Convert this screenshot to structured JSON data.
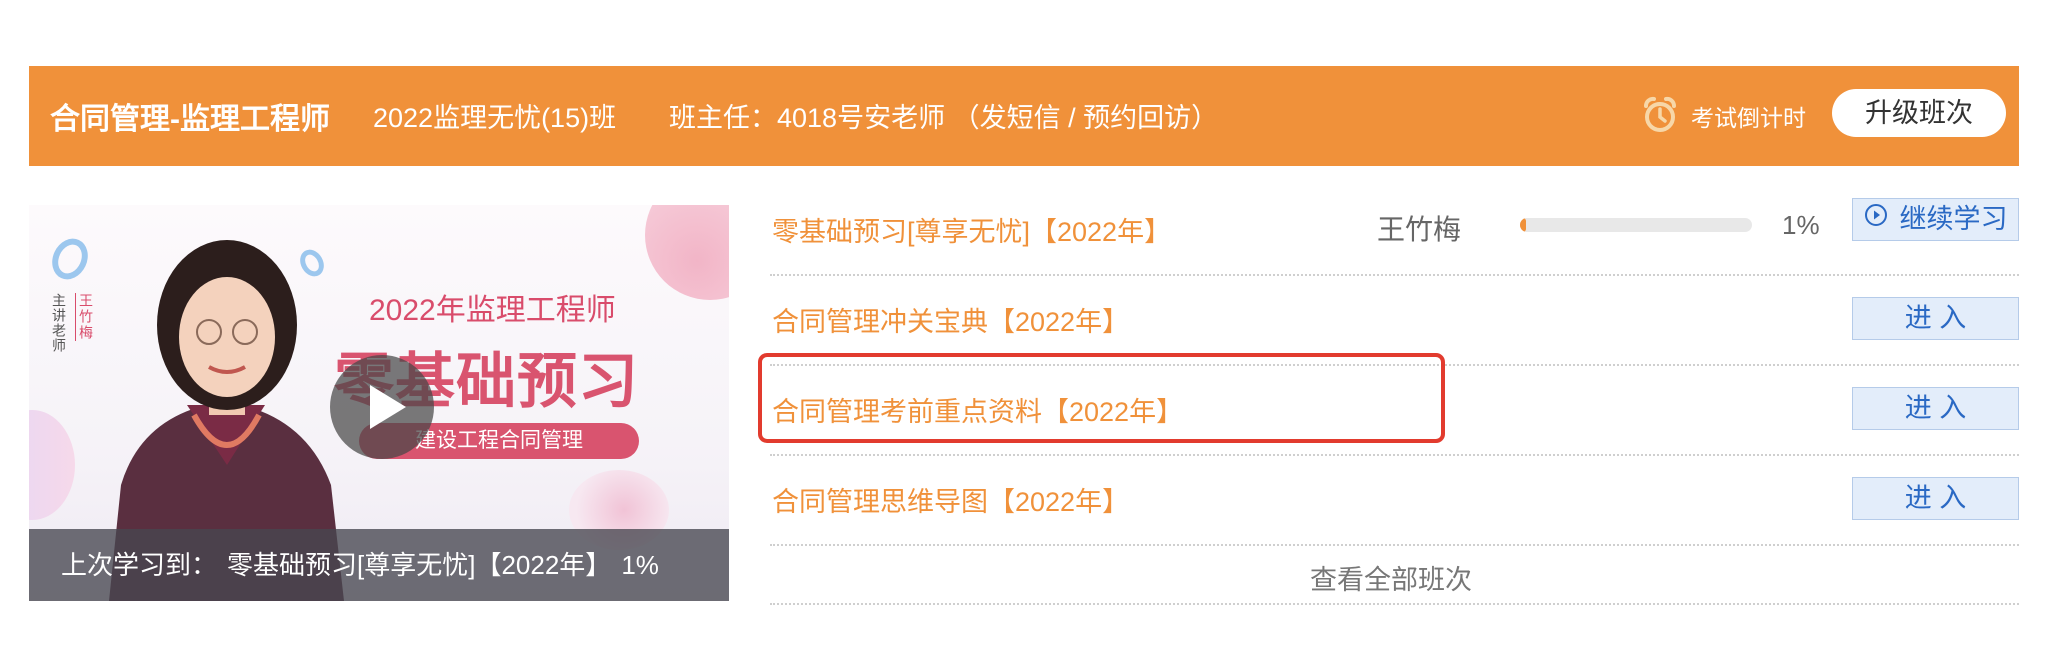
{
  "header": {
    "course_name": "合同管理-监理工程师",
    "class_name": "2022监理无忧(15)班",
    "teacher_prefix": "班主任：4018号安老师 （",
    "sms_link": "发短信",
    "separator": " / ",
    "callback_link": "预约回访",
    "teacher_suffix": "）",
    "countdown_label": "考试倒计时",
    "upgrade_button": "升级班次"
  },
  "thumbnail": {
    "lecturer_label": "主讲老师",
    "lecturer_name": "王竹梅",
    "promo_year": "2022年监理工程师",
    "promo_title": "零基础预习",
    "promo_subtitle": "建设工程合同管理",
    "last_study_label": "上次学习到：",
    "last_study_course": "零基础预习[尊享无忧]【2022年】",
    "last_study_progress": "1%"
  },
  "courses": [
    {
      "title": "零基础预习[尊享无忧]【2022年】",
      "instructor": "王竹梅",
      "progress": 0.01,
      "progress_text": "1%",
      "button": "继续学习"
    },
    {
      "title": "合同管理冲关宝典【2022年】",
      "button": "进 入"
    },
    {
      "title": "合同管理考前重点资料【2022年】",
      "button": "进 入"
    },
    {
      "title": "合同管理思维导图【2022年】",
      "button": "进 入"
    }
  ],
  "view_all": "查看全部班次",
  "icons": {
    "countdown": "alarm-clock-icon",
    "play": "play-icon",
    "continue": "play-circle-icon"
  },
  "colors": {
    "accent": "#f0913a",
    "button_text": "#2a69c4",
    "highlight": "#e23b2e",
    "brand_pink": "#d9546f"
  }
}
